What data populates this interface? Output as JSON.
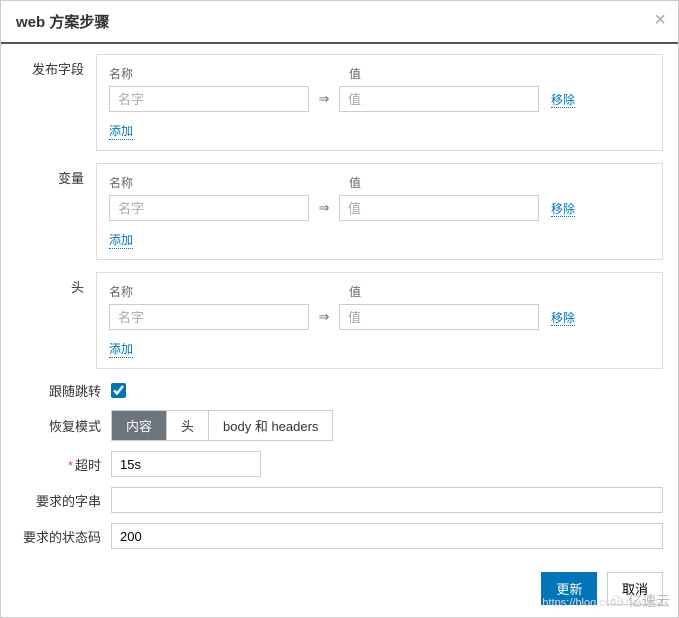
{
  "modal": {
    "title": "web 方案步骤"
  },
  "sections": {
    "post_fields": {
      "label": "发布字段",
      "name_header": "名称",
      "value_header": "值",
      "name_placeholder": "名字",
      "value_placeholder": "值",
      "remove_label": "移除",
      "add_label": "添加"
    },
    "variables": {
      "label": "变量",
      "name_header": "名称",
      "value_header": "值",
      "name_placeholder": "名字",
      "value_placeholder": "值",
      "remove_label": "移除",
      "add_label": "添加"
    },
    "headers": {
      "label": "头",
      "name_header": "名称",
      "value_header": "值",
      "name_placeholder": "名字",
      "value_placeholder": "值",
      "remove_label": "移除",
      "add_label": "添加"
    }
  },
  "form": {
    "follow_redirect": {
      "label": "跟随跳转",
      "checked": true
    },
    "retrieve_mode": {
      "label": "恢复模式",
      "options": [
        "内容",
        "头",
        "body 和 headers"
      ],
      "selected": 0
    },
    "timeout": {
      "label": "超时",
      "value": "15s",
      "required": true
    },
    "required_string": {
      "label": "要求的字串",
      "value": ""
    },
    "status_codes": {
      "label": "要求的状态码",
      "value": "200"
    }
  },
  "footer": {
    "update_label": "更新",
    "cancel_label": "取消"
  },
  "arrow": "⇒",
  "watermark": "https://blog.csdn.net/we",
  "logo": "亿速云"
}
